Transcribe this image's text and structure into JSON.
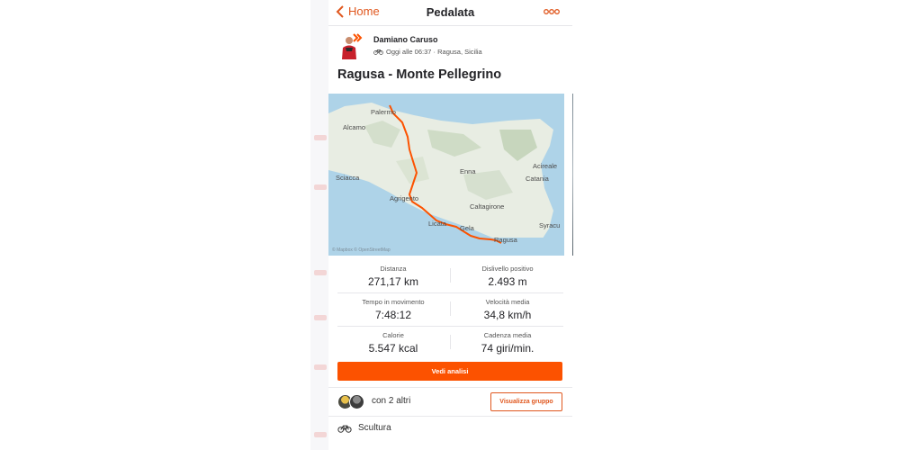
{
  "header": {
    "back_label": "Home",
    "title": "Pedalata"
  },
  "athlete": {
    "name": "Damiano Caruso",
    "meta": "Oggi alle 06:37 · Ragusa, Sicilia"
  },
  "activity": {
    "name": "Ragusa - Monte Pellegrino"
  },
  "map": {
    "places": [
      "Palermo",
      "Alcamo",
      "Sciacca",
      "Agrigento",
      "Enna",
      "Acireale",
      "Catania",
      "Caltagirone",
      "Syracu",
      "Licata",
      "Gela",
      "Ragusa"
    ],
    "credit": "© Mapbox © OpenStreetMap",
    "route_color": "#fc5200"
  },
  "stats": [
    {
      "label": "Distanza",
      "value": "271,17 km"
    },
    {
      "label": "Dislivello positivo",
      "value": "2.493 m"
    },
    {
      "label": "Tempo in movimento",
      "value": "7:48:12"
    },
    {
      "label": "Velocità media",
      "value": "34,8 km/h"
    },
    {
      "label": "Calorie",
      "value": "5.547 kcal"
    },
    {
      "label": "Cadenza media",
      "value": "74 giri/min."
    }
  ],
  "analysis_button": "Vedi analisi",
  "group": {
    "text": "con 2 altri",
    "button": "Visualizza gruppo"
  },
  "gear": {
    "name": "Scultura"
  },
  "colors": {
    "accent": "#fc5200",
    "text": "#242428",
    "map_water": "#aed3e8",
    "map_land": "#e8ede3"
  }
}
